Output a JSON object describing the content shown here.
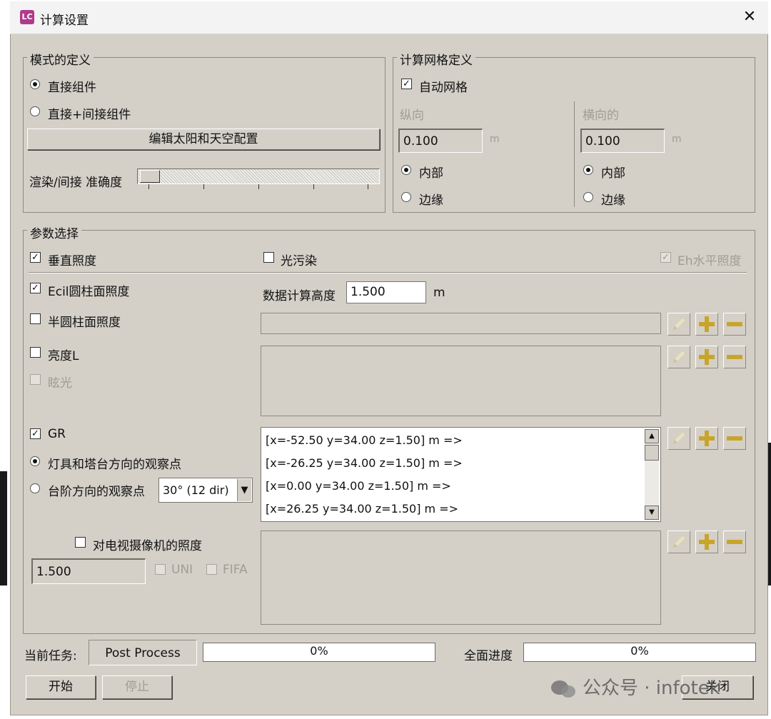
{
  "window": {
    "title": "计算设置",
    "app_icon": "LC",
    "close_label": "✕"
  },
  "mode_group": {
    "legend": "模式的定义",
    "radio_direct": "直接组件",
    "radio_direct_indirect": "直接+间接组件",
    "edit_sun_sky_button": "编辑太阳和天空配置",
    "accuracy_label": "渲染/间接 准确度",
    "accuracy_level": 0
  },
  "grid_group": {
    "legend": "计算网格定义",
    "auto_grid_label": "自动网格",
    "longitudinal": {
      "label": "纵向",
      "value": "0.100",
      "unit": "m",
      "inner": "内部",
      "edge": "边缘"
    },
    "transverse": {
      "label": "横向的",
      "value": "0.100",
      "unit": "m",
      "inner": "内部",
      "edge": "边缘"
    }
  },
  "params_group": {
    "legend": "参数选择",
    "vertical_illuminance": "垂直照度",
    "light_pollution": "光污染",
    "eh_horizontal": "Eh水平照度",
    "ecil": "Ecil圆柱面照度",
    "calc_height_label": "数据计算高度",
    "calc_height_value": "1.500",
    "calc_height_unit": "m",
    "semi_cyl": "半圆柱面照度",
    "luminance": "亮度L",
    "glare": "眩光",
    "gr": "GR",
    "gr_radio_lum": "灯具和塔台方向的观察点",
    "gr_radio_step": "台阶方向的观察点",
    "gr_select_value": "30° (12 dir)",
    "gr_points": [
      "[x=-52.50 y=34.00 z=1.50] m =>",
      "[x=-26.25 y=34.00 z=1.50] m =>",
      "[x=0.00 y=34.00 z=1.50] m =>",
      "[x=26.25 y=34.00 z=1.50] m =>"
    ],
    "tv_camera": "对电视摄像机的照度",
    "tv_value": "1.500",
    "uni_label": "UNI",
    "fifa_label": "FIFA"
  },
  "status": {
    "current_task_label": "当前任务:",
    "current_task_value": "Post Process",
    "task_progress_text": "0%",
    "task_progress": 0,
    "overall_label": "全面进度",
    "overall_progress_text": "0%",
    "overall_progress": 0
  },
  "buttons": {
    "start": "开始",
    "stop": "停止",
    "close": "关闭"
  },
  "watermark": {
    "text": "公众号 · infotek"
  },
  "colors": {
    "dialog_bg": "#d4d0c8",
    "icon_gold": "#c8a52a",
    "app_icon_bg": "#b03a8c"
  }
}
